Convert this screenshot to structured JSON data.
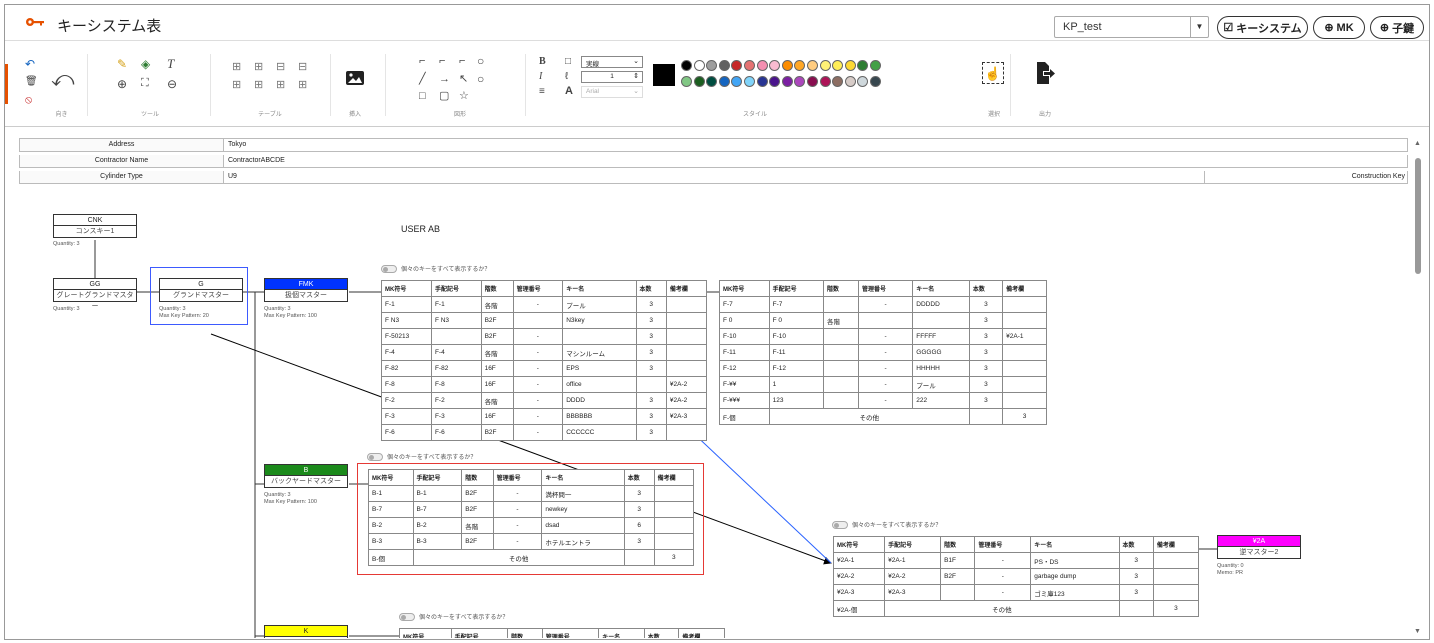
{
  "app": {
    "title": "キーシステム表",
    "project": "KP_test"
  },
  "header_buttons": {
    "keysystem": "キーシステム",
    "mk": "MK",
    "child": "子鍵"
  },
  "toolbar": {
    "groups": {
      "direction": "向き",
      "tools": "ツール",
      "table": "テーブル",
      "insert": "挿入",
      "shape": "図形",
      "style": "スタイル",
      "select": "選択",
      "output": "出力"
    },
    "line_style": "実線",
    "line_width": "1",
    "font": "Arial",
    "palette_row1": [
      "#000000",
      "#ffffff",
      "#9e9e9e",
      "#616161",
      "#c62828",
      "#e57373",
      "#f48fb1",
      "#f8bbd0",
      "#fb8c00",
      "#ffa726",
      "#ffcc80",
      "#fff176",
      "#ffee58",
      "#fdd835",
      "#2e7d32",
      "#43a047"
    ],
    "palette_row2": [
      "#81c784",
      "#1b5e20",
      "#004d40",
      "#1565c0",
      "#42a5f5",
      "#81d4fa",
      "#283593",
      "#4a148c",
      "#7b1fa2",
      "#ab47bc",
      "#880e4f",
      "#ad1457",
      "#8d6e63",
      "#d7ccc8",
      "#cfd8dc",
      "#37474f"
    ]
  },
  "info": [
    {
      "key": "Address",
      "value": "Tokyo"
    },
    {
      "key": "Contractor Name",
      "value": "ContractorABCDE"
    },
    {
      "key": "Cylinder Type",
      "value": "U9",
      "right": "Construction Key"
    }
  ],
  "canvas": {
    "user_label": "USER AB",
    "toggle_label": "個々のキーをすべて表示するか？",
    "nodes": {
      "cnk": {
        "code": "CNK",
        "name": "コンスキー1",
        "meta": "Quantity: 3"
      },
      "gg": {
        "code": "GG",
        "name": "グレートグランドマスター",
        "meta": "Quantity: 3"
      },
      "g": {
        "code": "G",
        "name": "グランドマスター",
        "meta1": "Quantity: 3",
        "meta2": "Max Key Pattern: 20"
      },
      "fmk": {
        "code": "FMK",
        "name": "扱個マスター",
        "meta1": "Quantity: 3",
        "meta2": "Max Key Pattern: 100"
      },
      "b": {
        "code": "B",
        "name": "バックヤードマスター",
        "meta1": "Quantity: 3",
        "meta2": "Max Key Pattern: 100"
      },
      "k": {
        "code": "K"
      },
      "y2a": {
        "code": "¥2A",
        "name": "逆マスター2",
        "meta1": "Quantity: 0",
        "meta2": "Memo: PR"
      }
    },
    "headers": [
      "MK符号",
      "手配記号",
      "階数",
      "管理番号",
      "キー名",
      "本数",
      "備考欄"
    ],
    "fmk_left": [
      [
        "F-1",
        "F-1",
        "各階",
        "-",
        "プール",
        "3",
        ""
      ],
      [
        "F N3",
        "F N3",
        "B2F",
        "",
        "N3key",
        "3",
        ""
      ],
      [
        "F-50213",
        "",
        "B2F",
        "-",
        "",
        "3",
        ""
      ],
      [
        "F-4",
        "F-4",
        "各階",
        "-",
        "マシンルーム",
        "3",
        ""
      ],
      [
        "F-82",
        "F-82",
        "16F",
        "-",
        "EPS",
        "3",
        ""
      ],
      [
        "F-8",
        "F-8",
        "16F",
        "-",
        "office",
        "",
        "¥2A-2"
      ],
      [
        "F-2",
        "F-2",
        "各階",
        "-",
        "DDDD",
        "3",
        "¥2A-2"
      ],
      [
        "F-3",
        "F-3",
        "16F",
        "-",
        "BBBBBB",
        "3",
        "¥2A-3"
      ],
      [
        "F-6",
        "F-6",
        "B2F",
        "-",
        "CCCCCC",
        "3",
        ""
      ]
    ],
    "fmk_right": [
      [
        "F-7",
        "F-7",
        "",
        "-",
        "DDDDD",
        "3",
        ""
      ],
      [
        "F 0",
        "F 0",
        "各階",
        "",
        "",
        "3",
        ""
      ],
      [
        "F-10",
        "F-10",
        "",
        "-",
        "FFFFF",
        "3",
        "¥2A-1"
      ],
      [
        "F-11",
        "F-11",
        "",
        "-",
        "GGGGG",
        "3",
        ""
      ],
      [
        "F-12",
        "F-12",
        "",
        "-",
        "HHHHH",
        "3",
        ""
      ],
      [
        "F-¥¥",
        "1",
        "",
        "-",
        "プール",
        "3",
        ""
      ],
      [
        "F-¥¥¥",
        "123",
        "",
        "-",
        "222",
        "3",
        ""
      ]
    ],
    "fmk_right_total": {
      "code": "F-個",
      "label": "その他",
      "count": "3"
    },
    "b_rows": [
      [
        "B-1",
        "B-1",
        "B2F",
        "-",
        "満杯問一",
        "3",
        ""
      ],
      [
        "B-7",
        "B-7",
        "B2F",
        "-",
        "newkey",
        "3",
        ""
      ],
      [
        "B-2",
        "B-2",
        "各階",
        "-",
        "dsad",
        "6",
        ""
      ],
      [
        "B-3",
        "B-3",
        "B2F",
        "-",
        "ホテルエントラ",
        "3",
        ""
      ]
    ],
    "b_total": {
      "code": "B-個",
      "label": "その他",
      "count": "3"
    },
    "y_rows": [
      [
        "¥2A-1",
        "¥2A-1",
        "B1F",
        "-",
        "PS・DS",
        "3",
        ""
      ],
      [
        "¥2A-2",
        "¥2A-2",
        "B2F",
        "-",
        "garbage dump",
        "3",
        ""
      ],
      [
        "¥2A-3",
        "¥2A-3",
        "",
        "-",
        "ゴミ庫123",
        "3",
        ""
      ]
    ],
    "y_total": {
      "code": "¥2A-個",
      "label": "その他",
      "count": "3"
    }
  }
}
